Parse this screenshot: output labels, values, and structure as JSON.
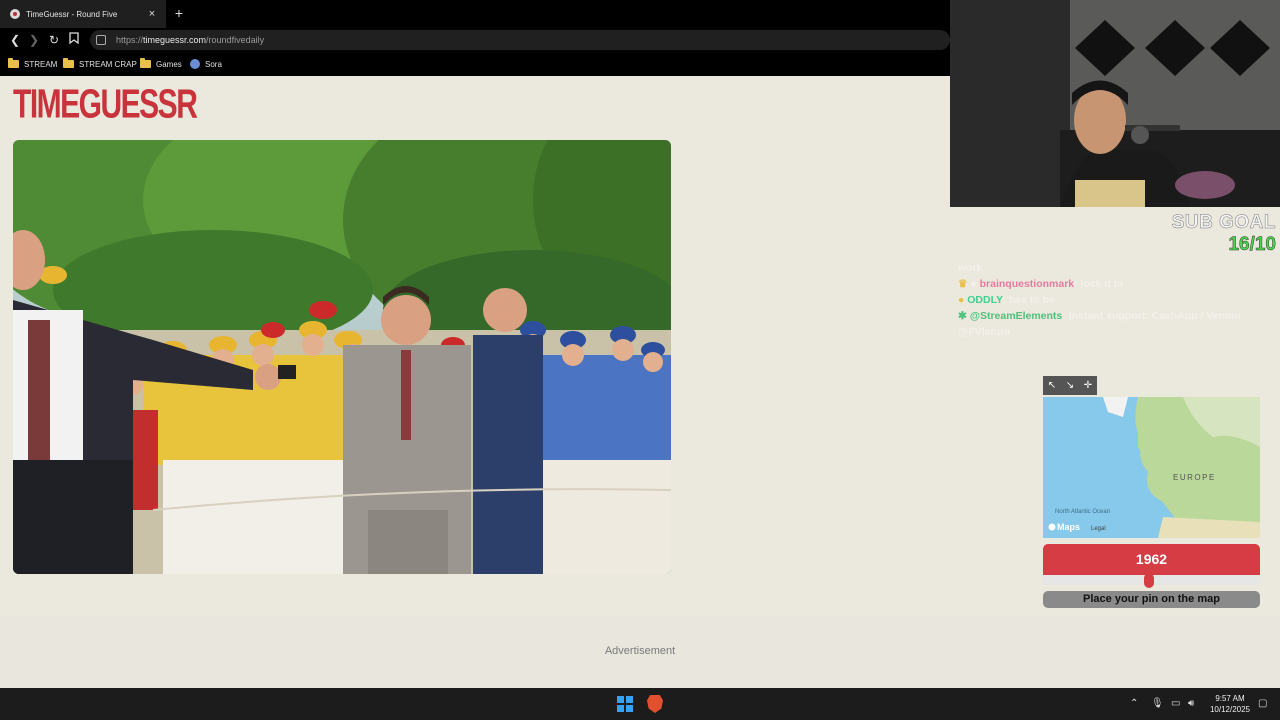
{
  "browser": {
    "tab_title": "TimeGuessr - Round Five",
    "tab_close": "×",
    "new_tab": "+",
    "url_scheme": "https://",
    "url_host": "timeguessr.com",
    "url_path": "/roundfivedaily",
    "bookmarks": [
      {
        "label": "STREAM",
        "icon": "folder-icon"
      },
      {
        "label": "STREAM CRAP",
        "icon": "folder-icon"
      },
      {
        "label": "Games",
        "icon": "folder-icon"
      },
      {
        "label": "Sora",
        "icon": "sora-icon"
      }
    ]
  },
  "page": {
    "logo": "TIMEGUESSR",
    "advertisement": "Advertisement"
  },
  "overlay": {
    "sub_goal_label": "SUB GOAL",
    "sub_goal_value": "16/10",
    "chat": [
      {
        "user": "",
        "text": "work."
      },
      {
        "user": "brainquestionmark",
        "text": ": lock it in"
      },
      {
        "user": "ODDLY",
        "text": ": has to be"
      },
      {
        "user": "@StreamElements",
        "text": ": Instant support: CashApp / Venmo @FVlatura"
      }
    ]
  },
  "game": {
    "map_label_region": "EUROPE",
    "map_label_ocean": "North Atlantic Ocean",
    "map_brand": "Maps",
    "map_legal": "Legal",
    "year": "1962",
    "year_fraction": 0.49,
    "place_pin": "Place your pin on the map"
  },
  "taskbar": {
    "time": "9:57 AM",
    "date": "10/12/2025"
  },
  "colors": {
    "brand_red": "#d53c44",
    "page_bg": "#ebe8de",
    "sub_goal_green": "#4bd84b"
  }
}
